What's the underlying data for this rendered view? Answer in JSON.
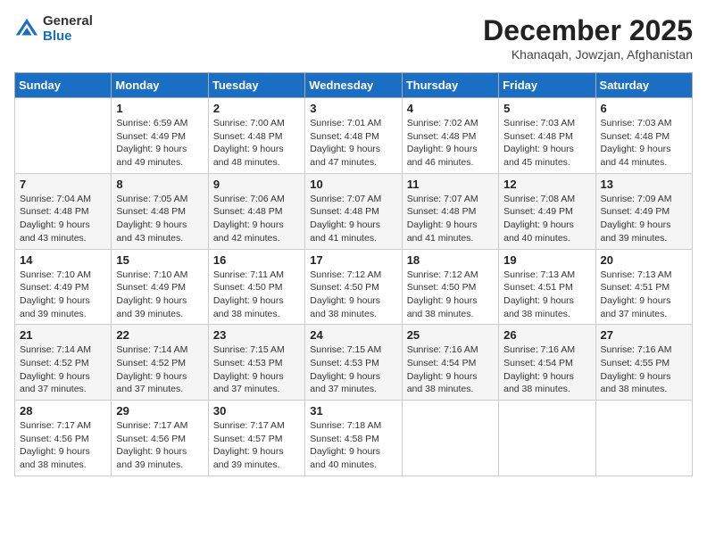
{
  "logo": {
    "general": "General",
    "blue": "Blue"
  },
  "title": "December 2025",
  "location": "Khanaqah, Jowzjan, Afghanistan",
  "days_header": [
    "Sunday",
    "Monday",
    "Tuesday",
    "Wednesday",
    "Thursday",
    "Friday",
    "Saturday"
  ],
  "weeks": [
    [
      {
        "day": "",
        "sunrise": "",
        "sunset": "",
        "daylight": ""
      },
      {
        "day": "1",
        "sunrise": "Sunrise: 6:59 AM",
        "sunset": "Sunset: 4:49 PM",
        "daylight": "Daylight: 9 hours and 49 minutes."
      },
      {
        "day": "2",
        "sunrise": "Sunrise: 7:00 AM",
        "sunset": "Sunset: 4:48 PM",
        "daylight": "Daylight: 9 hours and 48 minutes."
      },
      {
        "day": "3",
        "sunrise": "Sunrise: 7:01 AM",
        "sunset": "Sunset: 4:48 PM",
        "daylight": "Daylight: 9 hours and 47 minutes."
      },
      {
        "day": "4",
        "sunrise": "Sunrise: 7:02 AM",
        "sunset": "Sunset: 4:48 PM",
        "daylight": "Daylight: 9 hours and 46 minutes."
      },
      {
        "day": "5",
        "sunrise": "Sunrise: 7:03 AM",
        "sunset": "Sunset: 4:48 PM",
        "daylight": "Daylight: 9 hours and 45 minutes."
      },
      {
        "day": "6",
        "sunrise": "Sunrise: 7:03 AM",
        "sunset": "Sunset: 4:48 PM",
        "daylight": "Daylight: 9 hours and 44 minutes."
      }
    ],
    [
      {
        "day": "7",
        "sunrise": "Sunrise: 7:04 AM",
        "sunset": "Sunset: 4:48 PM",
        "daylight": "Daylight: 9 hours and 43 minutes."
      },
      {
        "day": "8",
        "sunrise": "Sunrise: 7:05 AM",
        "sunset": "Sunset: 4:48 PM",
        "daylight": "Daylight: 9 hours and 43 minutes."
      },
      {
        "day": "9",
        "sunrise": "Sunrise: 7:06 AM",
        "sunset": "Sunset: 4:48 PM",
        "daylight": "Daylight: 9 hours and 42 minutes."
      },
      {
        "day": "10",
        "sunrise": "Sunrise: 7:07 AM",
        "sunset": "Sunset: 4:48 PM",
        "daylight": "Daylight: 9 hours and 41 minutes."
      },
      {
        "day": "11",
        "sunrise": "Sunrise: 7:07 AM",
        "sunset": "Sunset: 4:48 PM",
        "daylight": "Daylight: 9 hours and 41 minutes."
      },
      {
        "day": "12",
        "sunrise": "Sunrise: 7:08 AM",
        "sunset": "Sunset: 4:49 PM",
        "daylight": "Daylight: 9 hours and 40 minutes."
      },
      {
        "day": "13",
        "sunrise": "Sunrise: 7:09 AM",
        "sunset": "Sunset: 4:49 PM",
        "daylight": "Daylight: 9 hours and 39 minutes."
      }
    ],
    [
      {
        "day": "14",
        "sunrise": "Sunrise: 7:10 AM",
        "sunset": "Sunset: 4:49 PM",
        "daylight": "Daylight: 9 hours and 39 minutes."
      },
      {
        "day": "15",
        "sunrise": "Sunrise: 7:10 AM",
        "sunset": "Sunset: 4:49 PM",
        "daylight": "Daylight: 9 hours and 39 minutes."
      },
      {
        "day": "16",
        "sunrise": "Sunrise: 7:11 AM",
        "sunset": "Sunset: 4:50 PM",
        "daylight": "Daylight: 9 hours and 38 minutes."
      },
      {
        "day": "17",
        "sunrise": "Sunrise: 7:12 AM",
        "sunset": "Sunset: 4:50 PM",
        "daylight": "Daylight: 9 hours and 38 minutes."
      },
      {
        "day": "18",
        "sunrise": "Sunrise: 7:12 AM",
        "sunset": "Sunset: 4:50 PM",
        "daylight": "Daylight: 9 hours and 38 minutes."
      },
      {
        "day": "19",
        "sunrise": "Sunrise: 7:13 AM",
        "sunset": "Sunset: 4:51 PM",
        "daylight": "Daylight: 9 hours and 38 minutes."
      },
      {
        "day": "20",
        "sunrise": "Sunrise: 7:13 AM",
        "sunset": "Sunset: 4:51 PM",
        "daylight": "Daylight: 9 hours and 37 minutes."
      }
    ],
    [
      {
        "day": "21",
        "sunrise": "Sunrise: 7:14 AM",
        "sunset": "Sunset: 4:52 PM",
        "daylight": "Daylight: 9 hours and 37 minutes."
      },
      {
        "day": "22",
        "sunrise": "Sunrise: 7:14 AM",
        "sunset": "Sunset: 4:52 PM",
        "daylight": "Daylight: 9 hours and 37 minutes."
      },
      {
        "day": "23",
        "sunrise": "Sunrise: 7:15 AM",
        "sunset": "Sunset: 4:53 PM",
        "daylight": "Daylight: 9 hours and 37 minutes."
      },
      {
        "day": "24",
        "sunrise": "Sunrise: 7:15 AM",
        "sunset": "Sunset: 4:53 PM",
        "daylight": "Daylight: 9 hours and 37 minutes."
      },
      {
        "day": "25",
        "sunrise": "Sunrise: 7:16 AM",
        "sunset": "Sunset: 4:54 PM",
        "daylight": "Daylight: 9 hours and 38 minutes."
      },
      {
        "day": "26",
        "sunrise": "Sunrise: 7:16 AM",
        "sunset": "Sunset: 4:54 PM",
        "daylight": "Daylight: 9 hours and 38 minutes."
      },
      {
        "day": "27",
        "sunrise": "Sunrise: 7:16 AM",
        "sunset": "Sunset: 4:55 PM",
        "daylight": "Daylight: 9 hours and 38 minutes."
      }
    ],
    [
      {
        "day": "28",
        "sunrise": "Sunrise: 7:17 AM",
        "sunset": "Sunset: 4:56 PM",
        "daylight": "Daylight: 9 hours and 38 minutes."
      },
      {
        "day": "29",
        "sunrise": "Sunrise: 7:17 AM",
        "sunset": "Sunset: 4:56 PM",
        "daylight": "Daylight: 9 hours and 39 minutes."
      },
      {
        "day": "30",
        "sunrise": "Sunrise: 7:17 AM",
        "sunset": "Sunset: 4:57 PM",
        "daylight": "Daylight: 9 hours and 39 minutes."
      },
      {
        "day": "31",
        "sunrise": "Sunrise: 7:18 AM",
        "sunset": "Sunset: 4:58 PM",
        "daylight": "Daylight: 9 hours and 40 minutes."
      },
      {
        "day": "",
        "sunrise": "",
        "sunset": "",
        "daylight": ""
      },
      {
        "day": "",
        "sunrise": "",
        "sunset": "",
        "daylight": ""
      },
      {
        "day": "",
        "sunrise": "",
        "sunset": "",
        "daylight": ""
      }
    ]
  ]
}
